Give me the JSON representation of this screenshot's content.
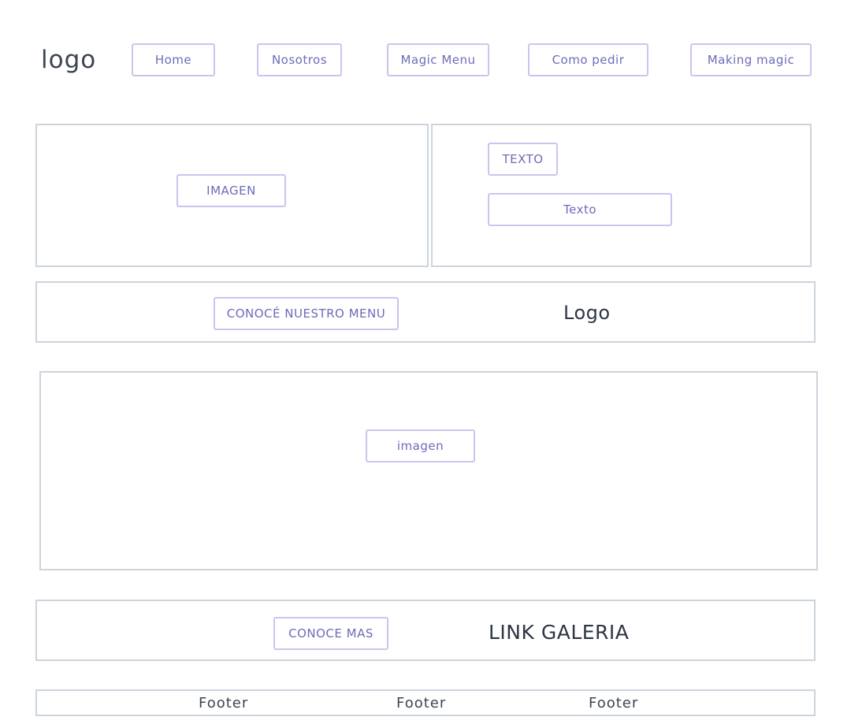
{
  "header": {
    "logo": "logo",
    "nav": [
      "Home",
      "Nosotros",
      "Magic Menu",
      "Como pedir",
      "Making magic"
    ]
  },
  "hero": {
    "image_label": "IMAGEN",
    "title_label": "TEXTO",
    "text_label": "Texto"
  },
  "menu_section": {
    "button_label": "CONOCÉ NUESTRO MENU",
    "logo_label": "Logo"
  },
  "banner": {
    "image_label": "imagen"
  },
  "gallery_section": {
    "button_label": "CONOCE MAS",
    "link_label": "LINK GALERIA"
  },
  "footer": {
    "items": [
      "Footer",
      "Footer",
      "Footer"
    ]
  }
}
